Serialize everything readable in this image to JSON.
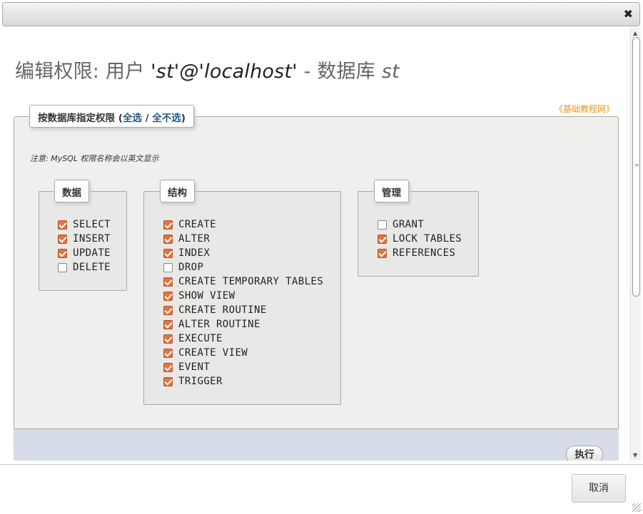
{
  "dialog": {
    "close_glyph": "✖",
    "cancel_label": "取消"
  },
  "title": {
    "prefix": "编辑权限: 用户 ",
    "user": "'st'@'localhost'",
    "separator": " - 数据库 ",
    "db": "st"
  },
  "doc_link": "《基础教程网》",
  "fieldset": {
    "legend_prefix": "按数据库指定权限 (",
    "select_all": "全选",
    "divider": " / ",
    "select_none": "全不选",
    "legend_suffix": ")",
    "note": "注意: MySQL 权限名称会以英文显示"
  },
  "groups": [
    {
      "name": "数据",
      "privileges": [
        {
          "label": "SELECT",
          "checked": true
        },
        {
          "label": "INSERT",
          "checked": true
        },
        {
          "label": "UPDATE",
          "checked": true
        },
        {
          "label": "DELETE",
          "checked": false
        }
      ]
    },
    {
      "name": "结构",
      "privileges": [
        {
          "label": "CREATE",
          "checked": true
        },
        {
          "label": "ALTER",
          "checked": true
        },
        {
          "label": "INDEX",
          "checked": true
        },
        {
          "label": "DROP",
          "checked": false
        },
        {
          "label": "CREATE TEMPORARY TABLES",
          "checked": true
        },
        {
          "label": "SHOW VIEW",
          "checked": true
        },
        {
          "label": "CREATE ROUTINE",
          "checked": true
        },
        {
          "label": "ALTER ROUTINE",
          "checked": true
        },
        {
          "label": "EXECUTE",
          "checked": true
        },
        {
          "label": "CREATE VIEW",
          "checked": true
        },
        {
          "label": "EVENT",
          "checked": true
        },
        {
          "label": "TRIGGER",
          "checked": true
        }
      ]
    },
    {
      "name": "管理",
      "privileges": [
        {
          "label": "GRANT",
          "checked": false
        },
        {
          "label": "LOCK TABLES",
          "checked": true
        },
        {
          "label": "REFERENCES",
          "checked": true
        }
      ]
    }
  ],
  "execute_label": "执行",
  "colors": {
    "checkbox_checked": "#e5733f",
    "link": "#235a81",
    "doc_link": "#e8941a"
  }
}
